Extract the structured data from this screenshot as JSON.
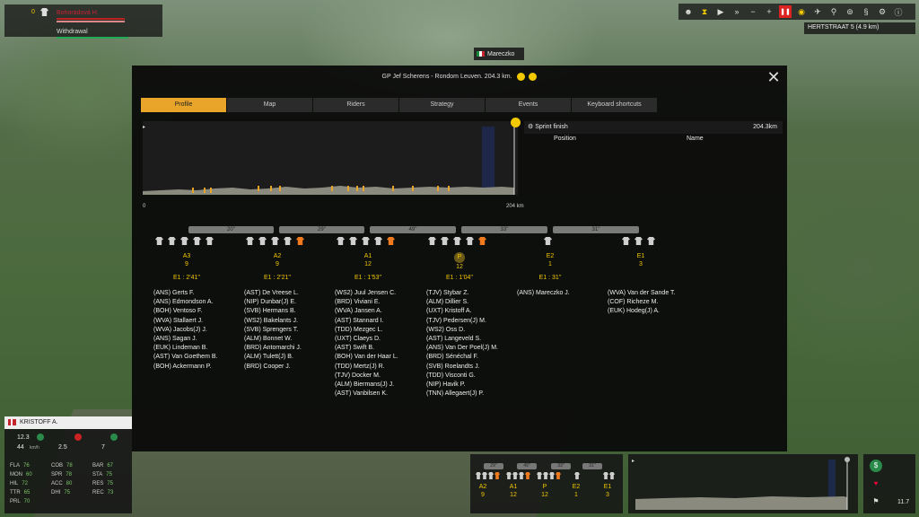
{
  "top_left": {
    "count": "0",
    "group": "Bohorádová H.",
    "withdrawal": "Withdrawal"
  },
  "toolbar": {
    "icons": [
      "rider-icon",
      "hourglass-icon",
      "play-icon",
      "fast-forward-icon",
      "minus-icon",
      "plus-icon",
      "pause-icon",
      "eye-icon",
      "helicopter-icon",
      "bike-icon",
      "tactics-icon",
      "weather-icon",
      "settings-icon",
      "info-icon"
    ]
  },
  "location": "HERTSTRAAT 5 (4.9 km)",
  "player_tag": "Mareczko",
  "panel": {
    "title": "GP Jef Scherens - Rondom Leuven. 204.3 km.",
    "tabs": [
      "Profile",
      "Map",
      "Riders",
      "Strategy",
      "Events",
      "Keyboard shortcuts"
    ],
    "active_tab": "Profile",
    "km_start": "0",
    "km_end": "204 km",
    "sprint_label": "Sprint finish",
    "sprint_km": "204.3km",
    "col_position": "Position",
    "col_name": "Name"
  },
  "gaps": [
    "20''",
    "29''",
    "49''",
    "33''",
    "31''"
  ],
  "groups": [
    {
      "label": "A3",
      "count": "9",
      "time": "E1 : 2'41''",
      "white": 5,
      "orange": 0,
      "riders": [
        "(ANS) Gerts F.",
        "(ANS) Edmondson A.",
        "(BOH) Ventoso F.",
        "(WVA) Stallaert J.",
        "(WVA) Jacobs(J) J.",
        "(ANS) Sagan J.",
        "(EUK) Lindeman B.",
        "(AST) Van Goethem B.",
        "(BOH) Ackermann P."
      ]
    },
    {
      "label": "A2",
      "count": "9",
      "time": "E1 : 2'21''",
      "white": 4,
      "orange": 1,
      "riders": [
        "(AST) De Vreese L.",
        "(NIP) Dunbar(J) E.",
        "(SVB) Hermans B.",
        "(WS2) Bakelants J.",
        "(SVB) Sprengers T.",
        "(ALM) Bonnet W.",
        "(BRD) Antomarchi J.",
        "(ALM) Tulett(J) B.",
        "(BRD) Cooper J."
      ]
    },
    {
      "label": "A1",
      "count": "12",
      "time": "E1 : 1'53''",
      "white": 4,
      "orange": 1,
      "riders": [
        "(WS2) Juul Jensen C.",
        "(BRD) Viviani E.",
        "(WVA) Jansen A.",
        "(AST) Stannard I.",
        "(TDD) Mezgec L.",
        "(UXT) Claeys D.",
        "(AST) Swift B.",
        "(BOH) Van der Haar L.",
        "(TDD) Mertz(J) R.",
        "(TJV) Docker M.",
        "(ALM) Biermans(J) J.",
        "(AST) Vanbilsen K."
      ]
    },
    {
      "label": "P",
      "count": "12",
      "time": "E1 : 1'04''",
      "white": 4,
      "orange": 1,
      "riders": [
        "(TJV) Stybar Z.",
        "(ALM) Dillier S.",
        "(UXT) Kristoff A.",
        "(TJV) Pedersen(J) M.",
        "(WS2) Oss D.",
        "(AST) Langeveld S.",
        "(ANS) Van Der Poel(J) M.",
        "(BRD) Sénéchal F.",
        "(SVB) Roelandts J.",
        "(TDD) Visconti G.",
        "(NIP) Havik P.",
        "(TNN) Allegaert(J) P."
      ]
    },
    {
      "label": "E2",
      "count": "1",
      "time": "E1 : 31''",
      "white": 1,
      "orange": 0,
      "riders": [
        "(ANS) Mareczko J."
      ]
    },
    {
      "label": "E1",
      "count": "3",
      "time": "",
      "white": 3,
      "orange": 0,
      "riders": [
        "(WVA) Van der Sande T.",
        "(COF) Richeze M.",
        "(EUK) Hodeg(J) A."
      ]
    }
  ],
  "rider_card": {
    "name": "KRISTOFF A.",
    "speed": "12.3",
    "speed_unit": "km/h",
    "effort": "44",
    "val1": "2.5",
    "val2": "7",
    "stats": [
      [
        "FLA",
        "76",
        "COB",
        "78",
        "BAR",
        "67"
      ],
      [
        "MON",
        "60",
        "SPR",
        "78",
        "STA",
        "75"
      ],
      [
        "HIL",
        "72",
        "ACC",
        "80",
        "RES",
        "75"
      ],
      [
        "TTR",
        "65",
        "DHI",
        "75",
        "REC",
        "73"
      ],
      [
        "PRL",
        "70",
        "",
        "",
        "",
        ""
      ]
    ]
  },
  "bottom_summary": {
    "gaps": [
      "29''",
      "49''",
      "33''",
      "31''"
    ],
    "labels": [
      {
        "l": "A2",
        "c": "9"
      },
      {
        "l": "A1",
        "c": "12"
      },
      {
        "l": "P",
        "c": "12"
      },
      {
        "l": "E2",
        "c": "1"
      },
      {
        "l": "E1",
        "c": "3"
      }
    ]
  },
  "bottom_right": {
    "value": "11.7"
  },
  "colors": {
    "accent": "#e8a529",
    "highlight": "#f2c800",
    "orange_jersey": "#f07a1e"
  }
}
